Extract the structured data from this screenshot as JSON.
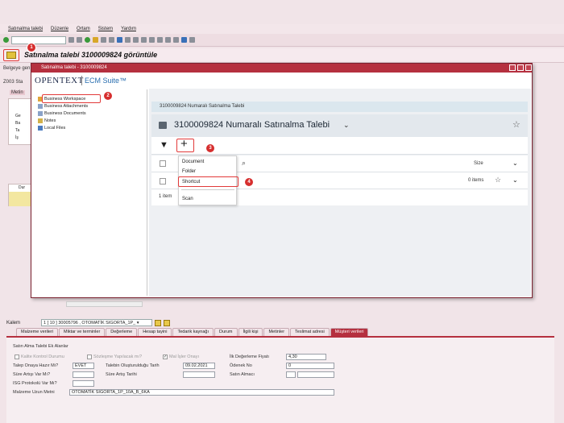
{
  "menu": [
    "Satınalma talebi",
    "Düzenle",
    "Ortam",
    "Sistem",
    "Yardım"
  ],
  "page_title": "Satınalma talebi 3100009824 görüntüle",
  "belgeye_label": "Belgeye gen",
  "z003_label": "Z003 Sta",
  "metin_label": "Metin",
  "left_tree": [
    "Ge",
    "Ba",
    "Ta",
    "İş"
  ],
  "grid_head": "Dur",
  "popup": {
    "title": "Satınalma talebi - 3100009824",
    "logo": "OPENTEXT",
    "suite": "ECM Suite™",
    "tree": [
      "Business Workspace",
      "Business Attachments",
      "Business Documents",
      "Notes",
      "Local Files"
    ],
    "breadcrumb": "3100009824 Numaralı Satınalma Talebi",
    "workspace_title": "3100009824 Numaralı Satınalma Talebi",
    "add_symbol": "+",
    "col_size": "Size",
    "items_count": "0 items",
    "footer_count": "1 item",
    "add_menu": [
      "Document",
      "Folder",
      "Shortcut",
      "Scan"
    ]
  },
  "badges": [
    "1",
    "2",
    "3",
    "4"
  ],
  "kalem": {
    "label": "Kalem",
    "value": "1 [ 10 ] 30005796 , OTOMATİK SIGORTA_1P_ ▾"
  },
  "tabs": [
    "Malzeme verileri",
    "Miktar ve terminler",
    "Değerleme",
    "Hesap tayini",
    "Tedarik kaynağı",
    "Durum",
    "İlgili kişi",
    "Metinler",
    "Teslimat adresi",
    "Müşteri verileri"
  ],
  "form": {
    "head": "Satın Alma Talebi Ek Alanlar",
    "kalite": "Kalite Kontrol Durumu",
    "sozlesme": "Sözleşme Yapılacak mı?",
    "mal_isler": "Mal İşler Onayı",
    "ilk_deg_label": "İlk Değerleme Fiyatı",
    "ilk_deg_value": "4,30",
    "talep_label": "Talep Onaya Hazır Mı?",
    "talep_value": "EVET",
    "olusturma_label": "Talebin Oluşturulduğu Tarih",
    "olusturma_value": "09.02.2021",
    "odenek_label": "Ödenek No",
    "odenek_value": "0",
    "sure_artis_label": "Süre Artışı Var Mı?",
    "sure_artis_tarih": "Süre Artış Tarihi",
    "satin_almaci": "Satın Almacı",
    "isg_label": "ISG Protokolü Var Mı?",
    "uzun_metin_label": "Malzeme Uzun Metni",
    "uzun_metin_value": "OTOMATİK SIGORTA_1P_10A_B_6KA"
  }
}
